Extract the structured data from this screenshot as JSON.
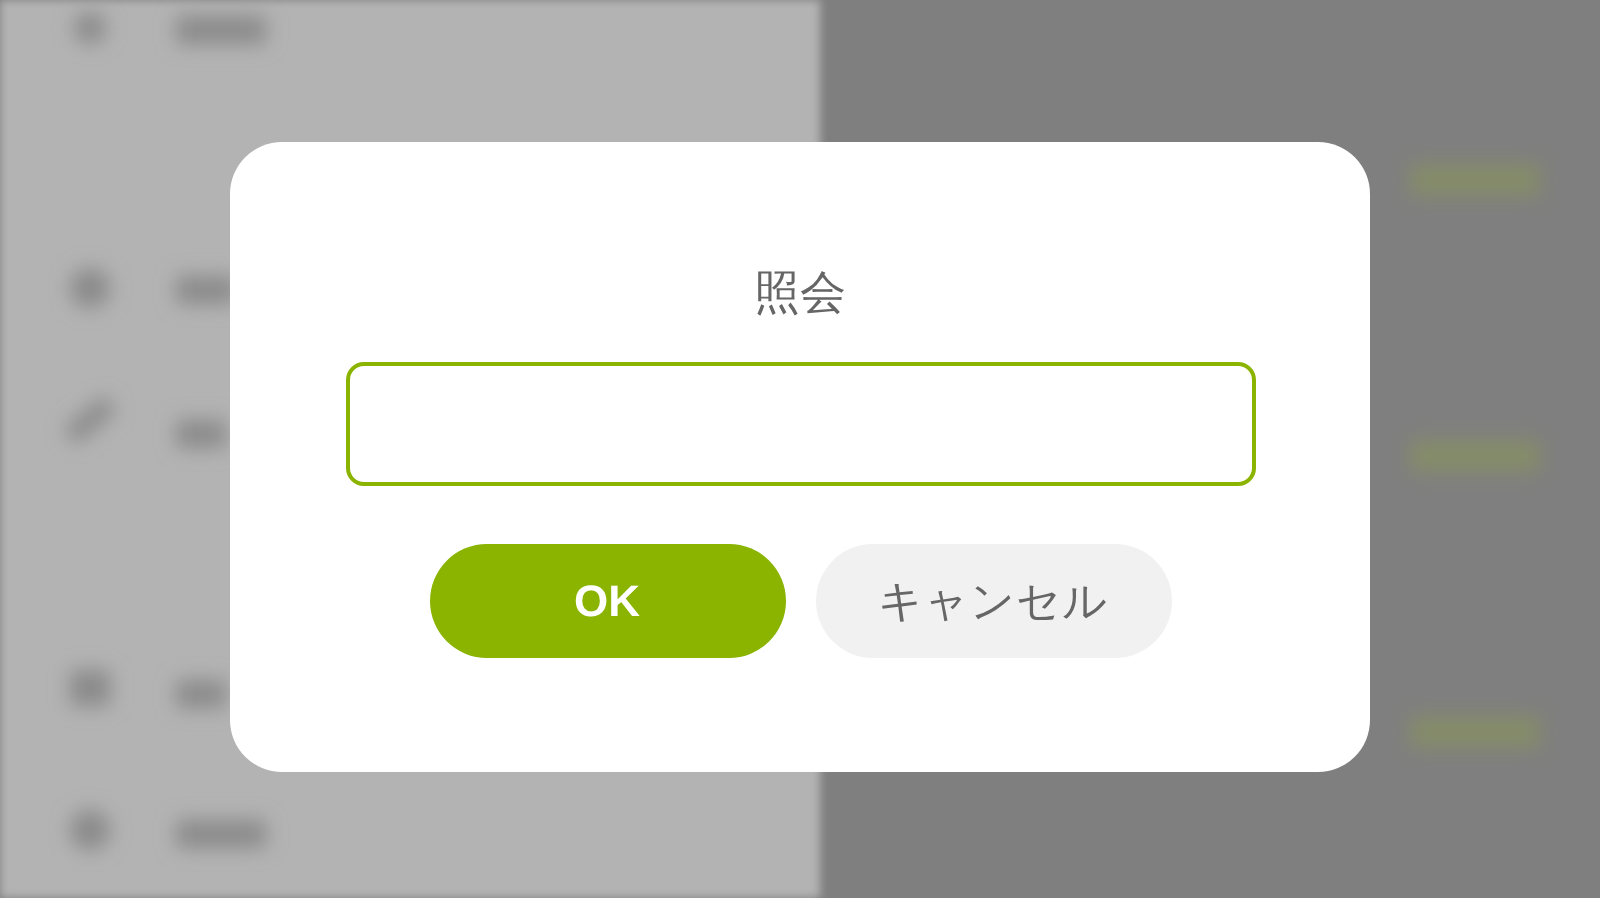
{
  "dialog": {
    "title": "照会",
    "buttons": [
      {
        "label": "OK",
        "kind": "primary"
      },
      {
        "label": "キャンセル",
        "kind": "secondary"
      }
    ]
  }
}
